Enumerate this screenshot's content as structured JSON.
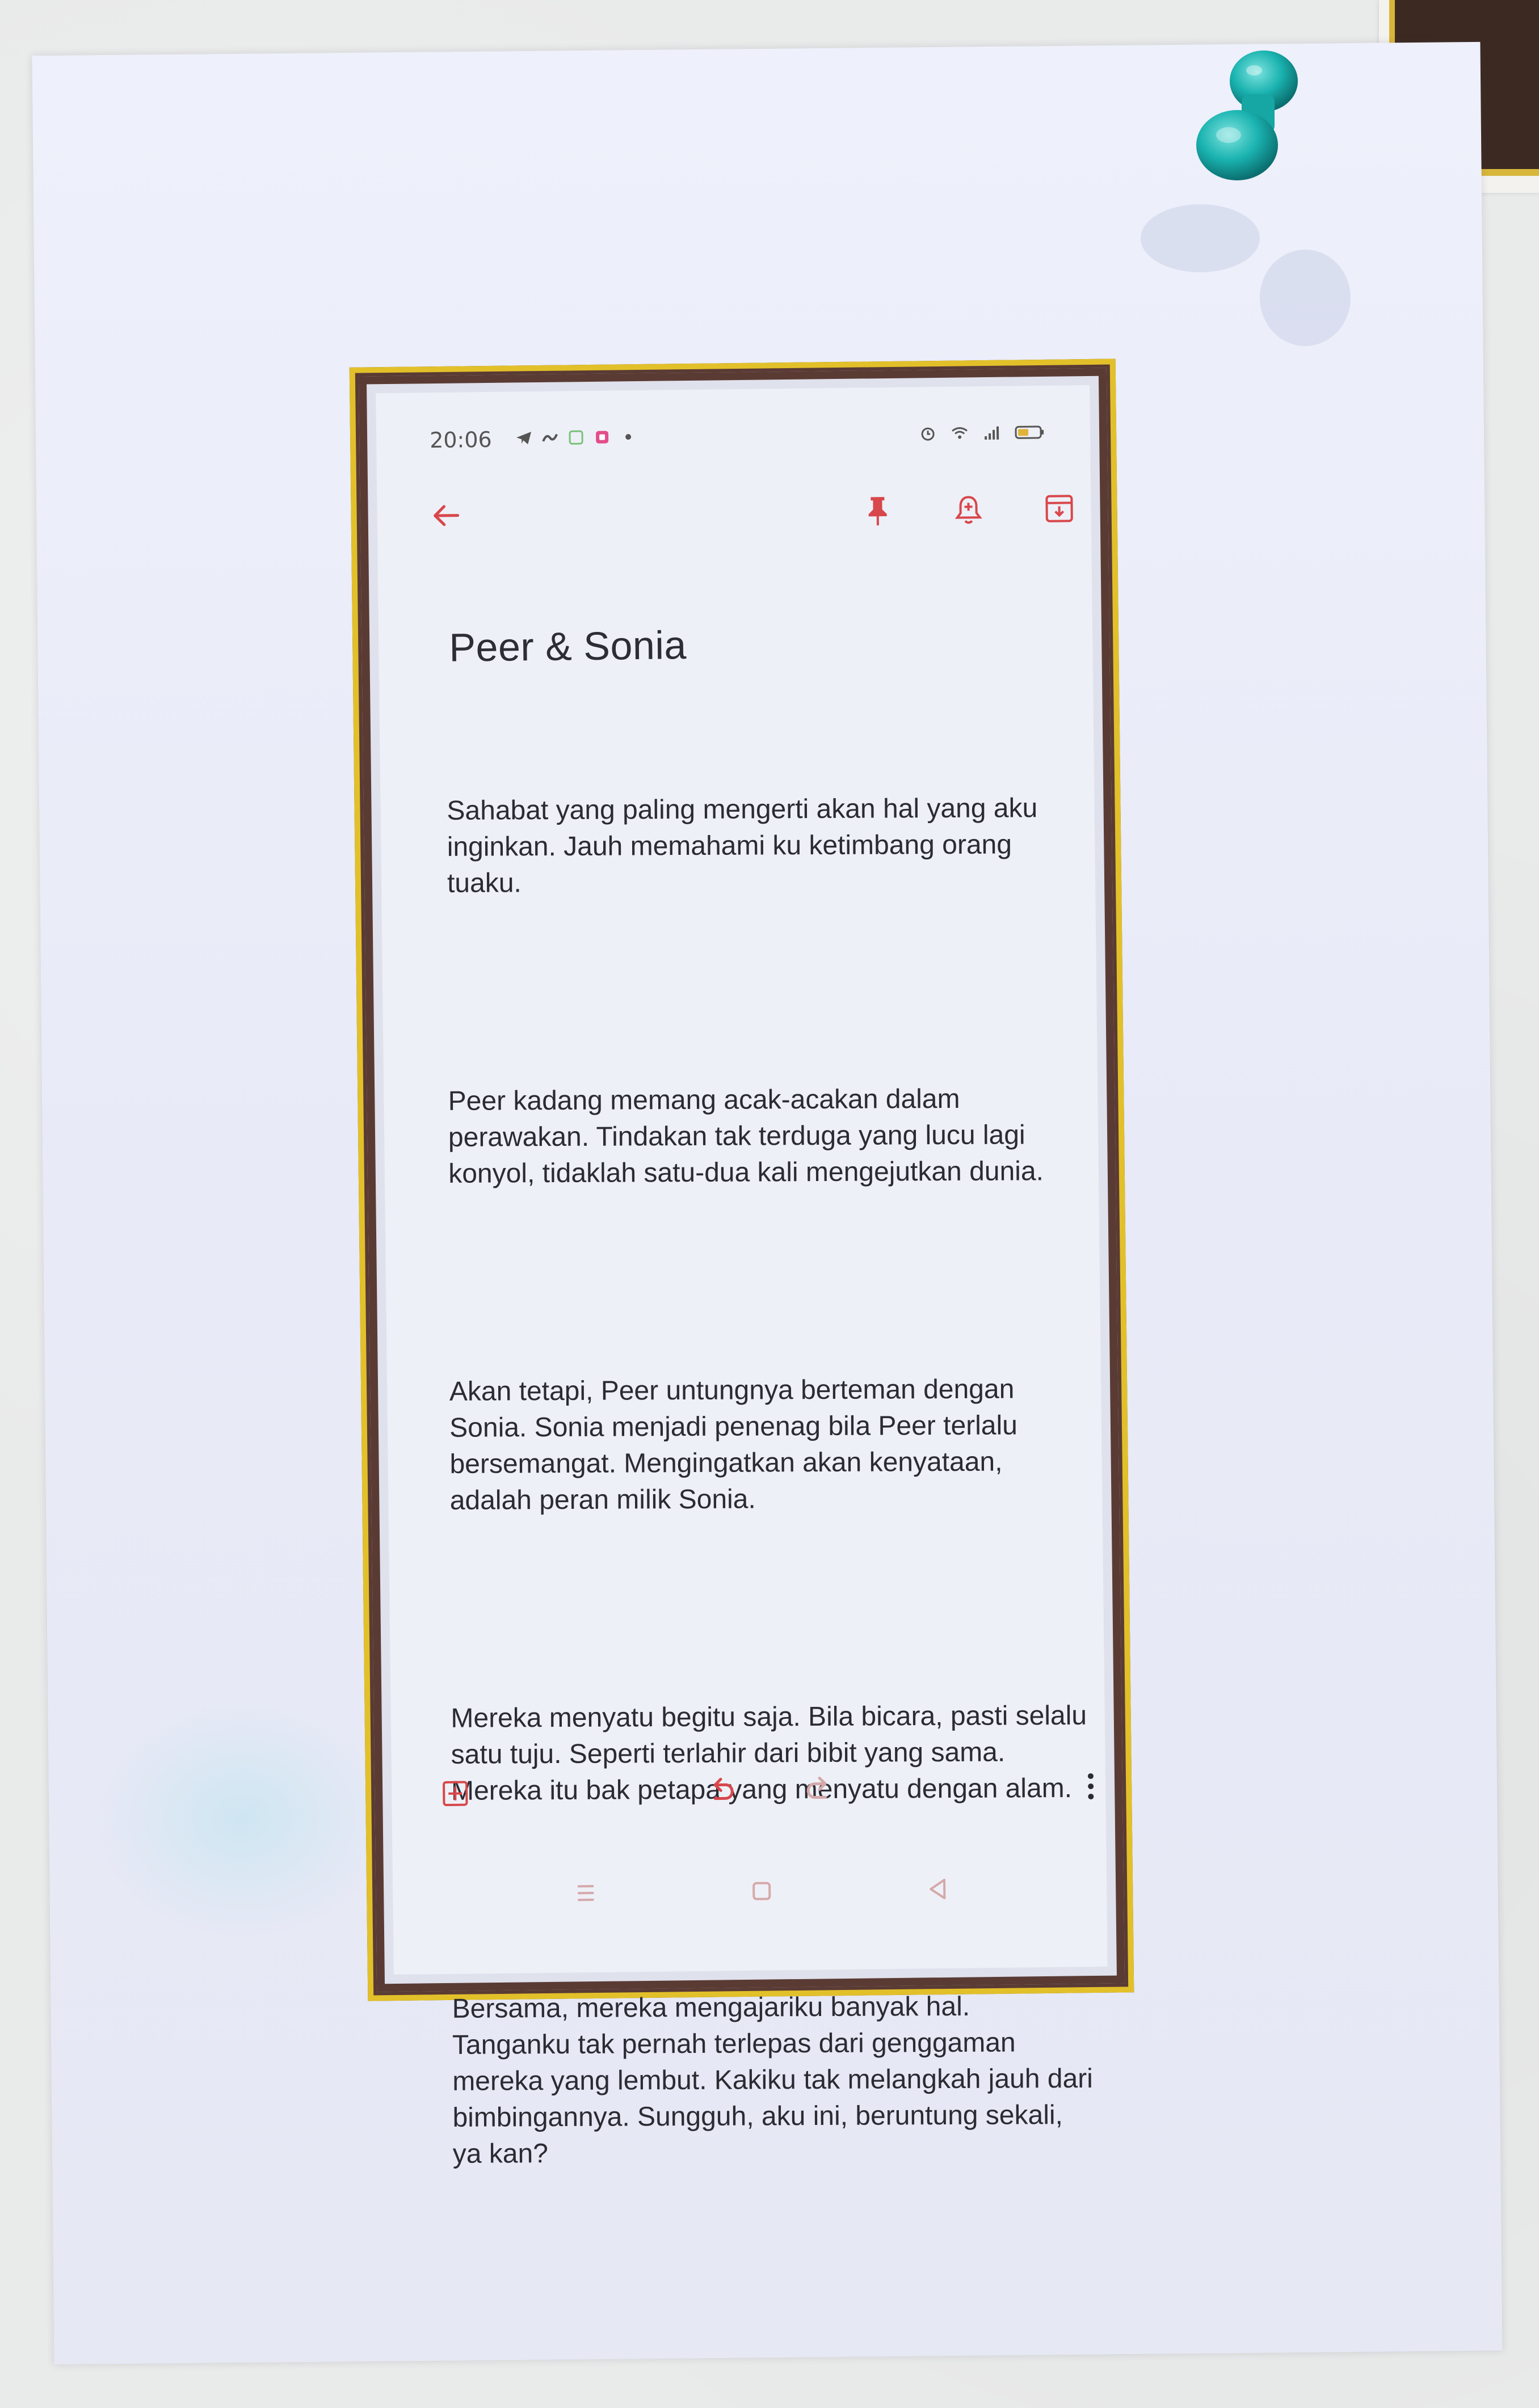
{
  "status_bar": {
    "time": "20:06"
  },
  "toolbar": {
    "back_icon": "arrow-left",
    "pin_icon": "pin",
    "reminder_icon": "bell-plus",
    "archive_icon": "archive-down"
  },
  "note": {
    "title": "Peer & Sonia",
    "paragraphs": [
      "Sahabat yang paling mengerti akan hal yang aku inginkan. Jauh memahami ku ketimbang orang tuaku.",
      "Peer kadang memang acak-acakan dalam perawakan. Tindakan tak terduga yang lucu lagi konyol, tidaklah satu-dua kali mengejutkan dunia.",
      "Akan tetapi, Peer untungnya berteman dengan Sonia. Sonia menjadi penenag bila Peer terlalu bersemangat. Mengingatkan akan kenyataan, adalah peran milik Sonia.",
      "Mereka menyatu begitu saja. Bila bicara, pasti selalu satu tuju. Seperti terlahir dari bibit yang sama. Mereka itu bak petapa yang menyatu dengan alam.",
      "Bersama, mereka mengajariku banyak hal. Tanganku tak pernah terlepas dari genggaman mereka yang lembut. Kakiku tak melangkah jauh dari bimbingannya. Sungguh, aku ini, beruntung sekali, ya kan?"
    ]
  },
  "bottom_bar": {
    "add_icon": "plus-box",
    "undo_icon": "undo",
    "redo_icon": "redo",
    "more_icon": "more-vertical"
  },
  "nav_bar": {
    "recents_icon": "menu-lines",
    "home_icon": "square",
    "back_icon": "triangle-left"
  },
  "colors": {
    "frame_yellow": "#e2c02a",
    "frame_brown": "#5a3b34",
    "pin_teal": "#1ab3b0",
    "paper": "#eef0fb",
    "text": "#2b2b33"
  }
}
